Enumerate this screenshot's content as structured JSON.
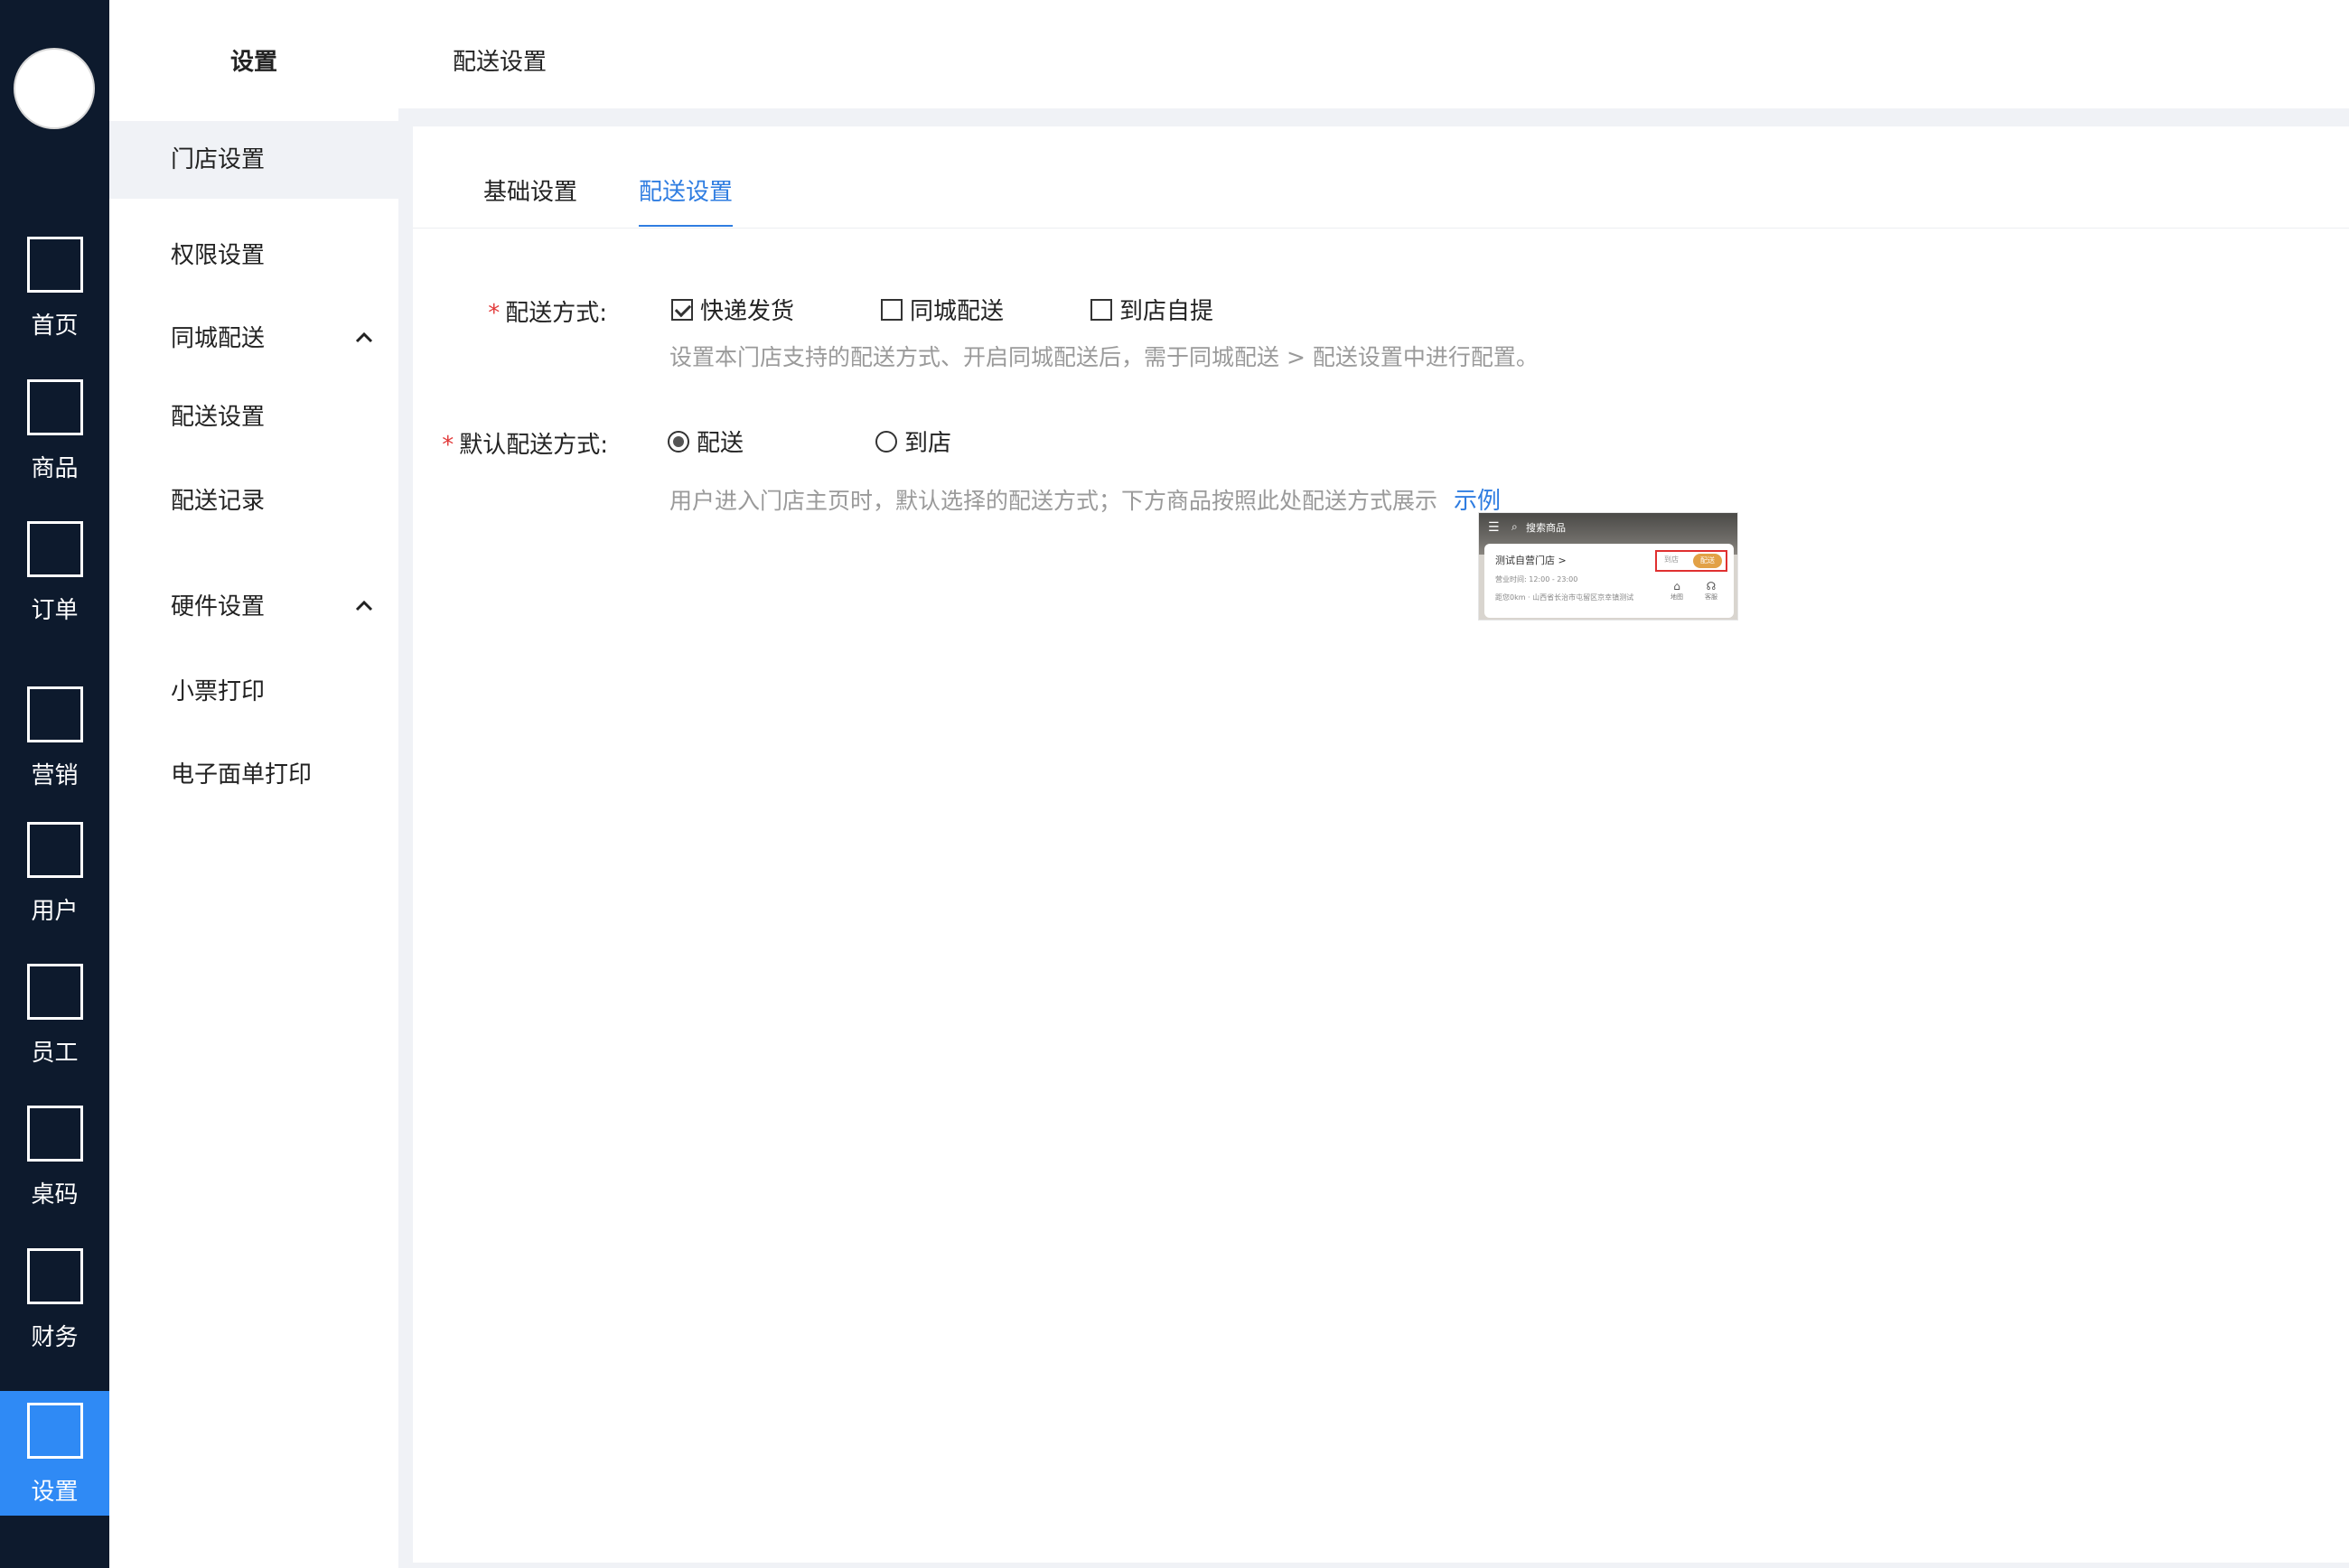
{
  "rail": {
    "items": [
      {
        "label": "首页",
        "icon": "home-icon"
      },
      {
        "label": "商品",
        "icon": "goods-icon"
      },
      {
        "label": "订单",
        "icon": "orders-icon"
      },
      {
        "label": "营销",
        "icon": "marketing-icon"
      },
      {
        "label": "用户",
        "icon": "users-icon"
      },
      {
        "label": "员工",
        "icon": "staff-icon"
      },
      {
        "label": "桌码",
        "icon": "table-code-icon"
      },
      {
        "label": "财务",
        "icon": "finance-icon"
      },
      {
        "label": "设置",
        "icon": "settings-icon",
        "active": true
      }
    ],
    "active_color": "#2f8af5",
    "background": "#0d1a2d"
  },
  "sidebar": {
    "title": "设置",
    "items": [
      {
        "label": "门店设置",
        "active": true
      },
      {
        "label": "权限设置"
      },
      {
        "label": "同城配送",
        "expandable": true
      },
      {
        "label": "配送设置"
      },
      {
        "label": "配送记录"
      },
      {
        "label": "硬件设置",
        "expandable": true
      },
      {
        "label": "小票打印"
      },
      {
        "label": "电子面单打印"
      }
    ]
  },
  "header": {
    "title": "配送设置"
  },
  "tabs": [
    {
      "label": "基础设置",
      "active": false
    },
    {
      "label": "配送设置",
      "active": true
    }
  ],
  "form": {
    "delivery_method": {
      "label": "配送方式:",
      "options": [
        {
          "label": "快递发货",
          "checked": true
        },
        {
          "label": "同城配送",
          "checked": false
        },
        {
          "label": "到店自提",
          "checked": false
        }
      ],
      "hint": "设置本门店支持的配送方式、开启同城配送后，需于同城配送 > 配送设置中进行配置。"
    },
    "default_method": {
      "label": "默认配送方式:",
      "options": [
        {
          "label": "配送",
          "checked": true
        },
        {
          "label": "到店",
          "checked": false
        }
      ],
      "hint": "用户进入门店主页时，默认选择的配送方式；下方商品按照此处配送方式展示",
      "example_link": "示例"
    }
  },
  "example_preview": {
    "search_text": "搜索商品",
    "store_name": "测试自营门店 >",
    "hours": "营业时间: 12:00 - 23:00",
    "address": "距您0km · 山西省长治市屯留区京幸镇测试",
    "pill_left": "到店",
    "pill_right": "配送",
    "icon_a": "地图",
    "icon_b": "客服"
  },
  "colors": {
    "accent": "#2f7de1",
    "required": "#e23b3b",
    "hint": "#9a9a9a"
  }
}
